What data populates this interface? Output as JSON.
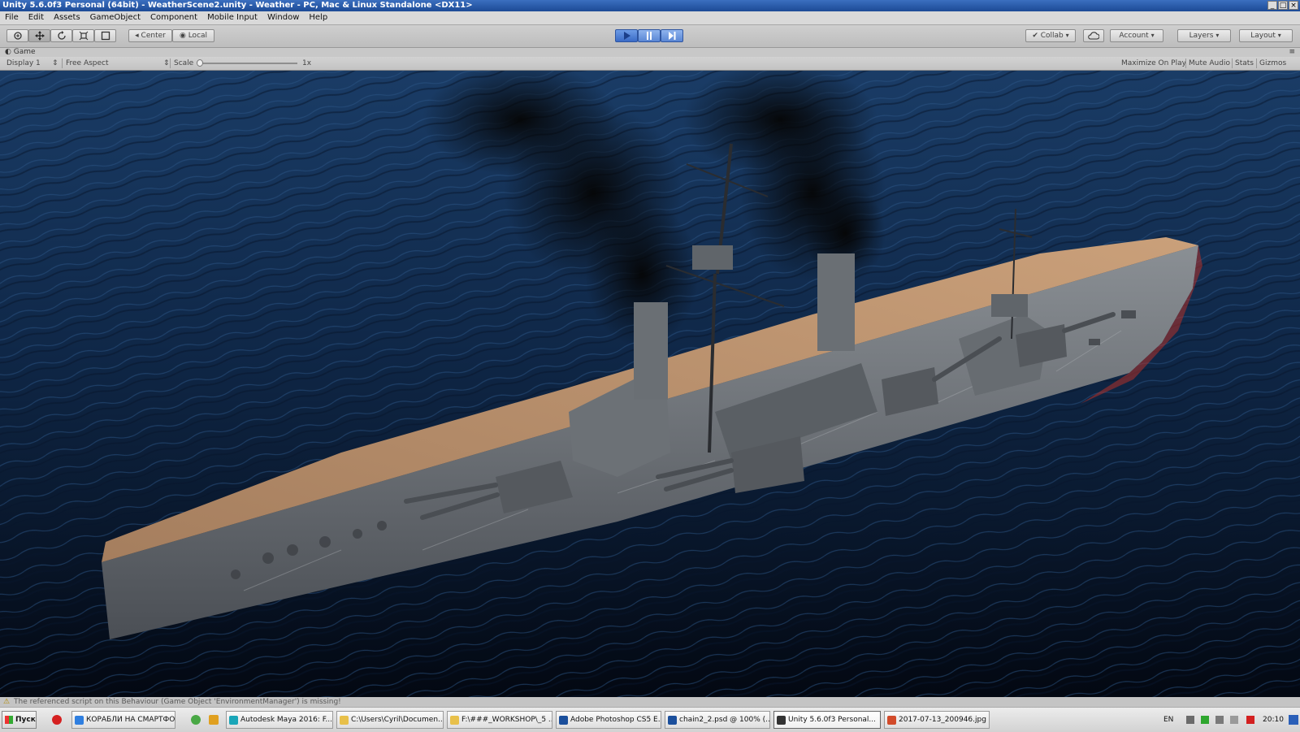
{
  "window": {
    "title": "Unity 5.6.0f3 Personal (64bit) - WeatherScene2.unity - Weather - PC, Mac & Linux Standalone <DX11>",
    "controls": [
      "_",
      "□",
      "×"
    ]
  },
  "menu": [
    "File",
    "Edit",
    "Assets",
    "GameObject",
    "Component",
    "Mobile Input",
    "Window",
    "Help"
  ],
  "toolbar": {
    "tools": [
      "hand-tool",
      "move-tool",
      "rotate-tool",
      "scale-tool",
      "rect-tool"
    ],
    "pivot_label": "Center",
    "space_label": "Local",
    "play_icons": [
      "play-icon",
      "pause-icon",
      "step-icon"
    ],
    "collab_label": "Collab",
    "account_label": "Account",
    "layers_label": "Layers",
    "layout_label": "Layout"
  },
  "game_view": {
    "tab_label": "Game",
    "display_label": "Display 1",
    "aspect_label": "Free Aspect",
    "scale_label": "Scale",
    "scale_value": "1x",
    "maximize_label": "Maximize On Play",
    "mute_label": "Mute Audio",
    "stats_label": "Stats",
    "gizmos_label": "Gizmos"
  },
  "console": {
    "message": "The referenced script on this Behaviour (Game Object 'EnvironmentManager') is missing!"
  },
  "taskbar": {
    "start_label": "Пуск",
    "tasks": [
      {
        "label": "КОРАБЛИ НА СМАРТФО...",
        "color": "#2f7fe0"
      },
      {
        "label": "Autodesk Maya 2016: F...",
        "color": "#1aa6b8"
      },
      {
        "label": "C:\\Users\\Cyril\\Documen...",
        "color": "#e8c04a"
      },
      {
        "label": "F:\\###_WORKSHOP\\_5 ...",
        "color": "#e8c04a"
      },
      {
        "label": "Adobe Photoshop CS5 E...",
        "color": "#1b4f9c"
      },
      {
        "label": "chain2_2.psd @ 100% (...",
        "color": "#1b4f9c"
      },
      {
        "label": "Unity 5.6.0f3 Personal...",
        "color": "#333333",
        "active": true
      },
      {
        "label": "2017-07-13_200946.jpg ...",
        "color": "#d24b2a"
      }
    ],
    "lang": "EN",
    "clock": "20:10"
  },
  "colors": {
    "title_bar": "#2454a6",
    "play_active": "#4a7fd6",
    "sea": "#0a1b33",
    "deck": "#b78a62",
    "hull": "#7f8489",
    "smoke": "#0b0b0b"
  }
}
